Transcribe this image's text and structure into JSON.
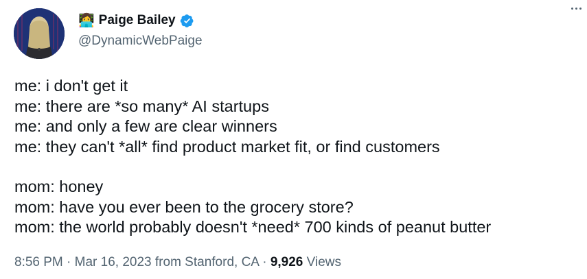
{
  "author": {
    "emoji": "👩‍💻",
    "display_name": "Paige Bailey",
    "handle": "@DynamicWebPaige",
    "verified": true
  },
  "tweet_lines_part1": [
    "me: i don't get it",
    "me: there are *so many* AI startups",
    "me: and only a few are clear winners",
    "me: they can't *all* find product market fit, or find customers"
  ],
  "tweet_lines_part2": [
    "mom: honey",
    "mom: have you ever been to the grocery store?",
    "mom: the world probably doesn't *need* 700 kinds of peanut butter"
  ],
  "meta": {
    "time": "8:56 PM",
    "date": "Mar 16, 2023",
    "source": "from Stanford, CA",
    "views_count": "9,926",
    "views_label": "Views",
    "separator": "·"
  },
  "icons": {
    "verified": "verified-badge-icon",
    "more": "more-icon"
  },
  "colors": {
    "verified_blue": "#1d9bf0",
    "text_primary": "#0f1419",
    "text_secondary": "#536471"
  }
}
